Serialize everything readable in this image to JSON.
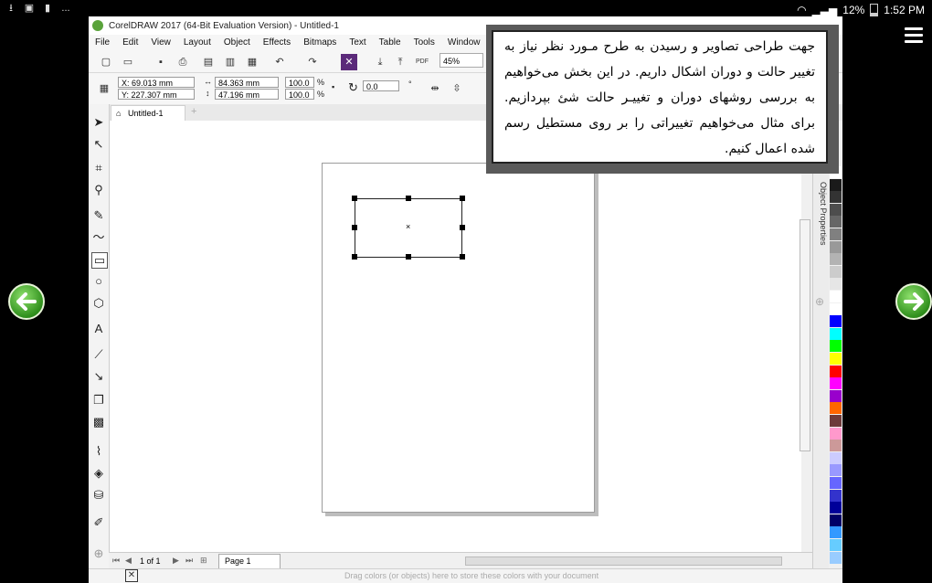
{
  "status_bar": {
    "time": "1:52 PM",
    "battery": "12%",
    "left_icons": [
      "download-icon",
      "image-icon",
      "sd-card-icon",
      "more-icon"
    ],
    "more_label": "..."
  },
  "app": {
    "title": "CorelDRAW 2017 (64-Bit Evaluation Version) - Untitled-1",
    "menu": [
      "File",
      "Edit",
      "View",
      "Layout",
      "Object",
      "Effects",
      "Bitmaps",
      "Text",
      "Table",
      "Tools",
      "Window"
    ],
    "zoom": "45%",
    "pos_x": "X: 69.013 mm",
    "pos_y": "Y: 227.307 mm",
    "width": "84.363 mm",
    "height": "47.196 mm",
    "scale_w": "100.0",
    "scale_h": "100.0",
    "percent": "%",
    "rotation": "0.0",
    "doc_tab": "Untitled-1",
    "page_counter": "1 of 1",
    "page_tab": "Page 1",
    "status_hint": "Drag colors (or objects) here to store these colors with your document",
    "dock_label": "Object Properties"
  },
  "overlay_text": "جهت طراحی تصاویر و رسیدن به طرح مـورد نظر نیاز به تغییر حالت و دوران اشکال داریم. در این بخش می‌خواهیم به بررسی روشهای دوران و تغییـر حالت شئ بپردازیم. برای مثال می‌خواهیم تغییراتی را بر روی مستطیل رسم شده اعمال کنیم.",
  "palette_colors": [
    "#ffffff",
    "#1a1a1a",
    "#333333",
    "#4d4d4d",
    "#666666",
    "#808080",
    "#999999",
    "#b3b3b3",
    "#cccccc",
    "#e6e6e6",
    "#ffffff",
    "#ffffff",
    "#0000ff",
    "#00ffff",
    "#00ff00",
    "#ffff00",
    "#ff0000",
    "#ff00ff",
    "#9900cc",
    "#ff6600",
    "#6e3a3a",
    "#ff99cc",
    "#cc9999",
    "#ccccff",
    "#9999ff",
    "#6666ff",
    "#3333cc",
    "#000099",
    "#000066",
    "#3399ff",
    "#66ccff",
    "#99ccff"
  ]
}
